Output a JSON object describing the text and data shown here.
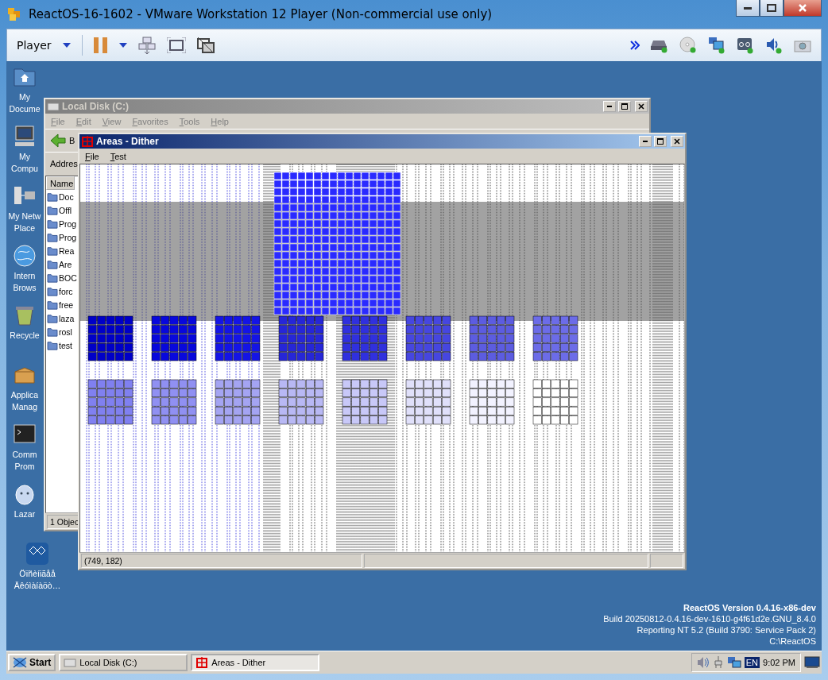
{
  "vm_window": {
    "title": "ReactOS-16-1602 - VMware Workstation 12 Player (Non-commercial use only)"
  },
  "vm_toolbar": {
    "player_menu": "Player"
  },
  "desktop_icons": [
    {
      "lines": [
        "My",
        "Docume"
      ]
    },
    {
      "lines": [
        "My",
        "Compu"
      ]
    },
    {
      "lines": [
        "My Netw",
        "Place"
      ]
    },
    {
      "lines": [
        "Intern",
        "Brows"
      ]
    },
    {
      "lines": [
        "Recycle"
      ]
    },
    {
      "lines": [
        "Applica",
        "Manag"
      ]
    },
    {
      "lines": [
        "Comm",
        "Prom"
      ]
    },
    {
      "lines": [
        "Lazar"
      ]
    },
    {
      "lines": [
        "Öïñèíiãåå",
        "Äêóìàíàöò…"
      ]
    }
  ],
  "explorer_window": {
    "title": "Local Disk (C:)",
    "active": false,
    "menu": [
      "File",
      "Edit",
      "View",
      "Favorites",
      "Tools",
      "Help"
    ],
    "back_button": "B",
    "address_label": "Addres",
    "column_1": "Name",
    "files": [
      "Doc",
      "Offl",
      "Prog",
      "Prog",
      "Rea",
      "Are",
      "BOC",
      "forc",
      "free",
      "laza",
      "rosl",
      "test"
    ],
    "status": "1 Objec"
  },
  "dither_window": {
    "title": "Areas - Dither",
    "active": true,
    "menu": [
      "File",
      "Test"
    ],
    "status_pane": "(749, 182)"
  },
  "version_info": [
    "ReactOS Version 0.4.16-x86-dev",
    "Build 20250812-0.4.16-dev-1610-g4f61d2e.GNU_8.4.0",
    "Reporting NT 5.2 (Build 3790: Service Pack 2)",
    "C:\\ReactOS"
  ],
  "taskbar": {
    "start": "Start",
    "tasks": [
      {
        "label": "Local Disk (C:)",
        "selected": false
      },
      {
        "label": "Areas - Dither",
        "selected": true
      }
    ],
    "language": "EN",
    "clock": "9:02 PM"
  }
}
